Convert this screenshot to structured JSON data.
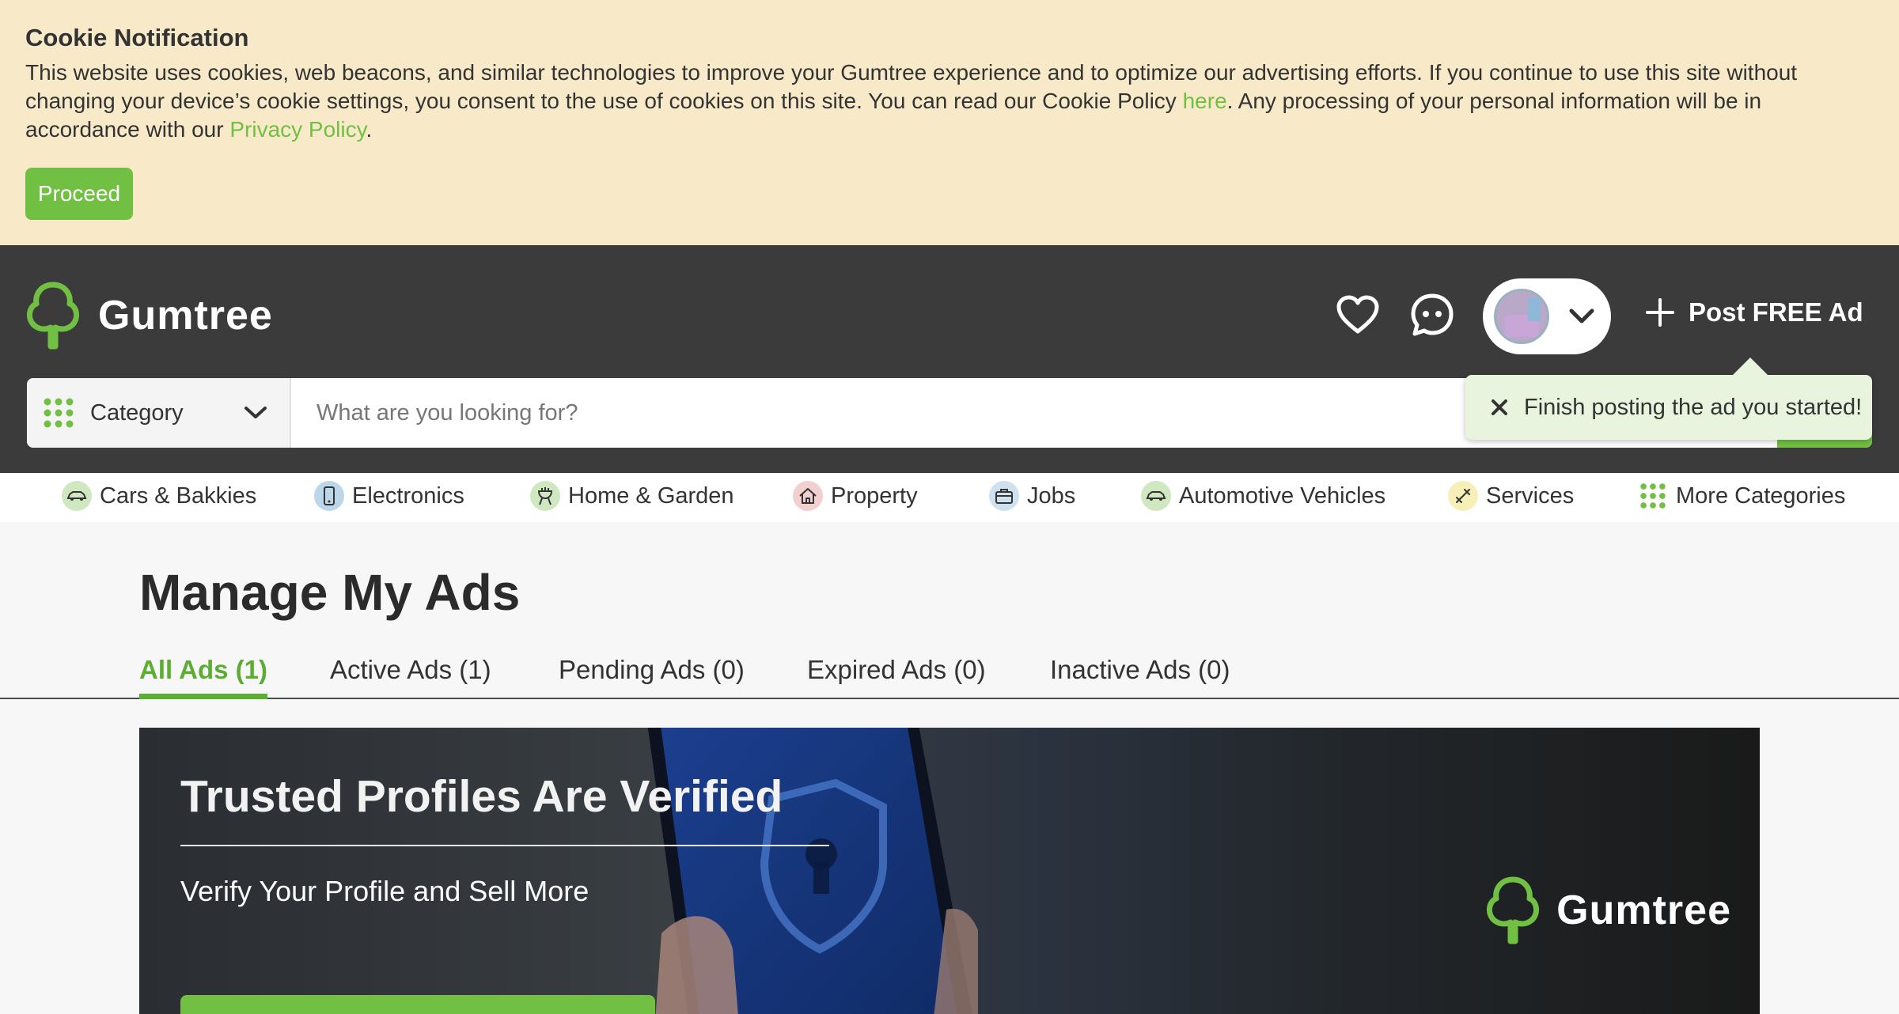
{
  "cookie": {
    "title": "Cookie Notification",
    "text_1": "This website uses cookies, web beacons, and similar technologies to improve your Gumtree experience and to optimize our advertising efforts. If you continue to use this site without changing your device’s cookie settings, you consent to the use of cookies on this site. You can read our Cookie Policy ",
    "here_link": "here",
    "text_2": ". Any processing of your personal information will be in accordance with our ",
    "privacy_link": "Privacy Policy",
    "text_3": ".",
    "proceed_label": "Proceed"
  },
  "header": {
    "logo_text": "Gumtree",
    "post_ad_label": "Post FREE Ad"
  },
  "search": {
    "category_label": "Category",
    "placeholder": "What are you looking for?"
  },
  "tooltip": {
    "text": "Finish posting the ad you started!"
  },
  "category_nav": [
    {
      "label": "Cars & Bakkies",
      "icon": "car-icon",
      "color": "#cfe8c0"
    },
    {
      "label": "Electronics",
      "icon": "phone-icon",
      "color": "#bcd6ea"
    },
    {
      "label": "Home & Garden",
      "icon": "grill-icon",
      "color": "#cfe8c0"
    },
    {
      "label": "Property",
      "icon": "house-icon",
      "color": "#f3d0d0"
    },
    {
      "label": "Jobs",
      "icon": "briefcase-icon",
      "color": "#cfe0ee"
    },
    {
      "label": "Automotive Vehicles",
      "icon": "car-icon",
      "color": "#cfe8c0"
    },
    {
      "label": "Services",
      "icon": "tools-icon",
      "color": "#f6f0b8"
    },
    {
      "label": "More Categories",
      "icon": "grid-icon",
      "color": "#ffffff"
    }
  ],
  "main": {
    "title": "Manage My Ads",
    "tabs": [
      {
        "label": "All Ads (1)"
      },
      {
        "label": "Active Ads (1)"
      },
      {
        "label": "Pending Ads (0)"
      },
      {
        "label": "Expired Ads (0)"
      },
      {
        "label": "Inactive Ads (0)"
      }
    ]
  },
  "banner": {
    "title": "Trusted Profiles Are Verified",
    "subtitle": "Verify Your Profile and Sell More",
    "logo_text": "Gumtree"
  },
  "colors": {
    "brand_green": "#72c043",
    "header_bg": "#3b3b3b",
    "cookie_bg": "#f8eac9"
  }
}
